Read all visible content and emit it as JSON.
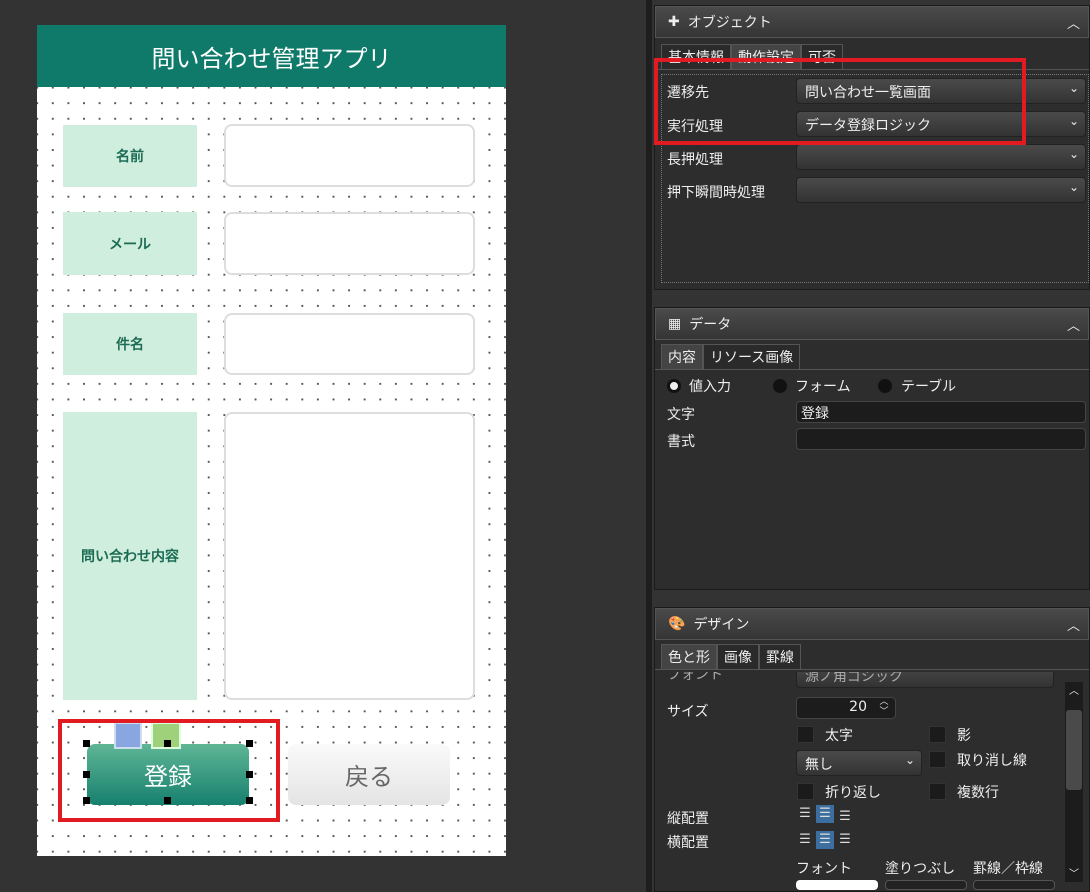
{
  "app": {
    "title": "問い合わせ管理アプリ",
    "fields": [
      {
        "label": "名前"
      },
      {
        "label": "メール"
      },
      {
        "label": "件名"
      },
      {
        "label": "問い合わせ内容"
      }
    ],
    "save_label": "登録",
    "back_label": "戻る"
  },
  "object_panel": {
    "title": "オブジェクト",
    "tabs": [
      "基本情報",
      "動作設定",
      "可否"
    ],
    "rows": [
      {
        "label": "遷移先",
        "value": "問い合わせ一覧画面"
      },
      {
        "label": "実行処理",
        "value": "データ登録ロジック"
      },
      {
        "label": "長押処理",
        "value": ""
      },
      {
        "label": "押下瞬間時処理",
        "value": ""
      }
    ]
  },
  "data_panel": {
    "title": "データ",
    "tabs": [
      "内容",
      "リソース画像"
    ],
    "radios": [
      "値入力",
      "フォーム",
      "テーブル"
    ],
    "text_label": "文字",
    "text_value": "登録",
    "format_label": "書式",
    "format_value": ""
  },
  "design_panel": {
    "title": "デザイン",
    "tabs": [
      "色と形",
      "画像",
      "罫線"
    ],
    "font_label": "フォント",
    "font_value": "源ノ角ゴシック",
    "size_label": "サイズ",
    "size_value": "20",
    "bold": "太字",
    "shadow": "影",
    "decoration_value": "無し",
    "strike": "取り消し線",
    "wrap": "折り返し",
    "multiline": "複数行",
    "valign_label": "縦配置",
    "halign_label": "横配置",
    "col_font": "フォント",
    "col_fill": "塗りつぶし",
    "col_border": "罫線／枠線"
  }
}
